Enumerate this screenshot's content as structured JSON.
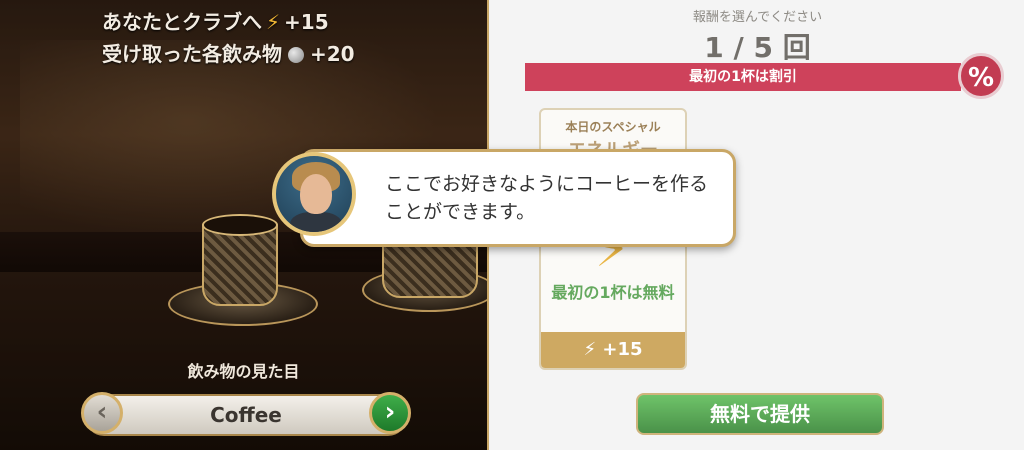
{
  "rewards": {
    "club_text": "あなたとクラブへ",
    "club_value": "+15",
    "drinks_text": "受け取った各飲み物",
    "drinks_value": "+20"
  },
  "drink_selector": {
    "label": "飲み物の見た目",
    "value": "Coffee",
    "prev_icon": "‹",
    "next_icon": "›"
  },
  "reward_panel": {
    "subtitle": "報酬を選んでください",
    "count": "1 / 5 回",
    "discount_banner": "最初の1杯は割引",
    "discount_badge": "%",
    "card": {
      "tag": "本日のスペシャル",
      "name": "エネルギー",
      "description": "最初の1杯は無料",
      "reward": "+15"
    },
    "serve_button": "無料で提供"
  },
  "tutorial": {
    "message": "ここでお好きなようにコーヒーを作ることができます。"
  },
  "colors": {
    "accent_red": "#c6223f",
    "accent_green": "#2b7f2a",
    "gold": "#c9a766",
    "energy": "#f1b634"
  },
  "icons": {
    "energy": "lightning-bolt-icon",
    "coin": "silver-coin-icon",
    "discount": "percent-badge-icon"
  }
}
